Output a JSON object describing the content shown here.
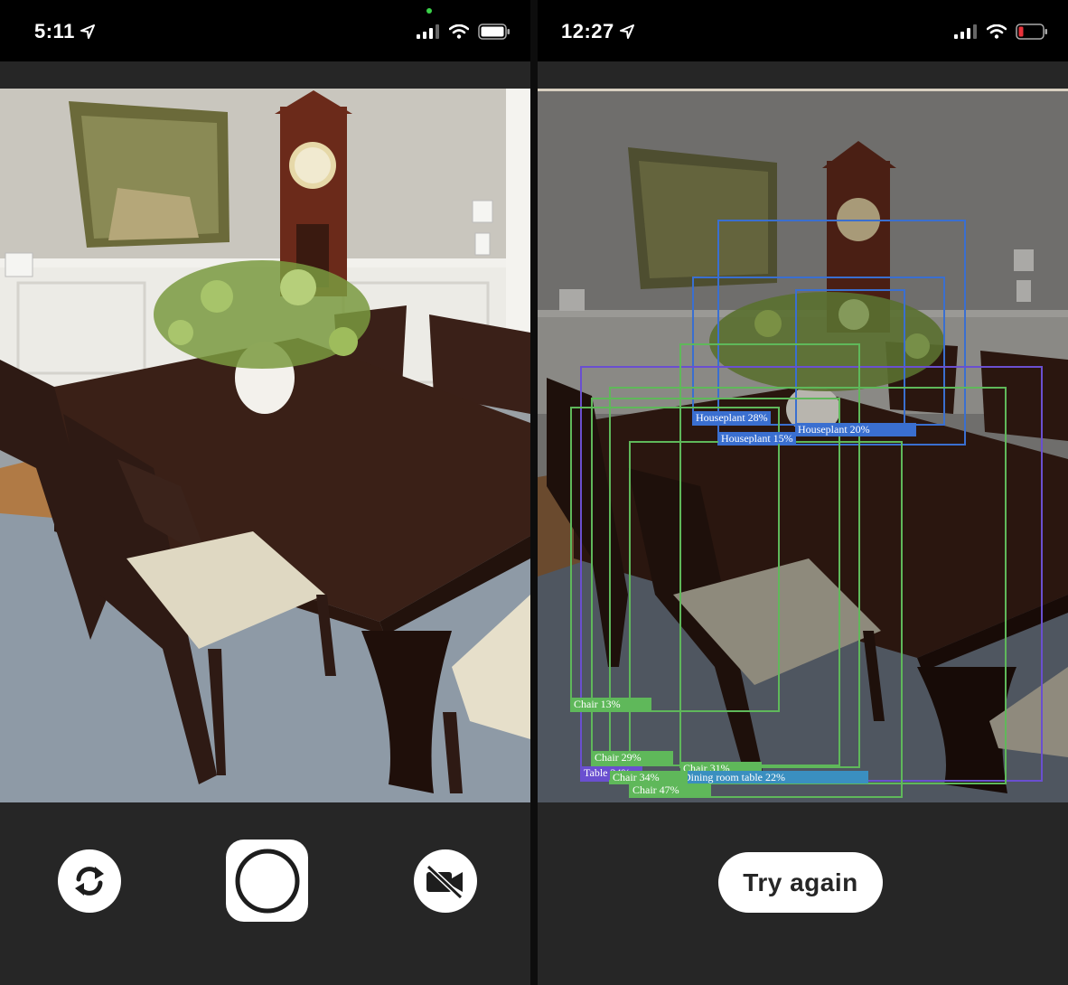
{
  "left_phone": {
    "status": {
      "time": "5:11"
    },
    "controls": {
      "flip_icon": "camera-flip-icon",
      "shutter_icon": "shutter-icon",
      "video_icon": "video-off-icon"
    }
  },
  "right_phone": {
    "status": {
      "time": "12:27"
    },
    "detections": [
      {
        "label": "Houseplant 28%",
        "color": "#3a6fd0"
      },
      {
        "label": "Houseplant 20%",
        "color": "#3a6fd0"
      },
      {
        "label": "Houseplant 15%",
        "color": "#3a6fd0"
      },
      {
        "label": "Chair 13%",
        "color": "#5fb85a"
      },
      {
        "label": "Chair 29%",
        "color": "#5fb85a"
      },
      {
        "label": "Chair 34%",
        "color": "#5fb85a"
      },
      {
        "label": "Chair 47%",
        "color": "#5fb85a"
      },
      {
        "label": "Chair 31%",
        "color": "#5fb85a"
      },
      {
        "label": "Table 24%",
        "color": "#6a4fd0"
      },
      {
        "label": "Dining room table 22%",
        "color": "#3a8fc0"
      }
    ],
    "button": {
      "label": "Try again"
    }
  },
  "colors": {
    "houseplant": "#3a6fd0",
    "chair": "#5fb85a",
    "table": "#6a4fd0",
    "dining_table": "#3a8fc0",
    "battery_low": "#e8323a",
    "indicator_dot": "#3bd14a"
  }
}
